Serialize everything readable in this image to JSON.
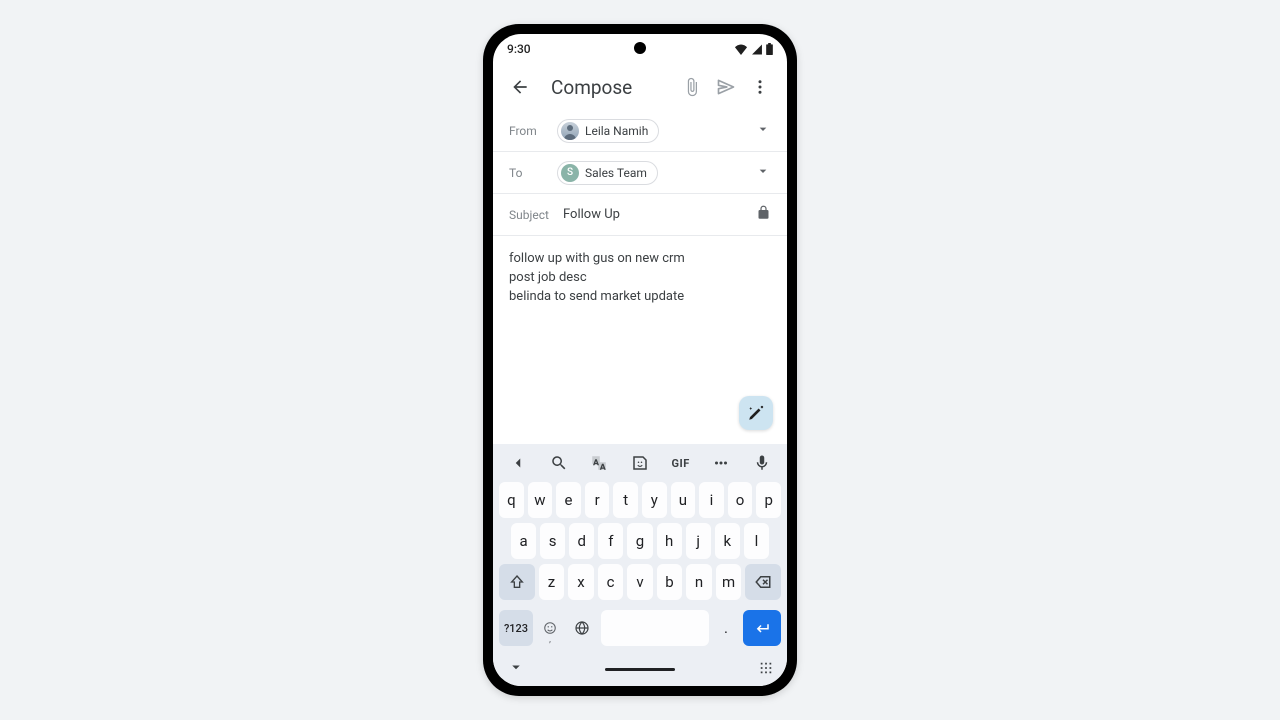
{
  "status": {
    "time": "9:30"
  },
  "header": {
    "title": "Compose"
  },
  "from": {
    "label": "From",
    "name": "Leila Namih"
  },
  "to": {
    "label": "To",
    "name": "Sales Team",
    "initial": "S"
  },
  "subject": {
    "label": "Subject",
    "value": "Follow Up"
  },
  "body": {
    "line1": "follow up with gus on new crm",
    "line2": "post job desc",
    "line3": "belinda to send market update"
  },
  "kb": {
    "gif": "GIF",
    "r1": {
      "k0": "q",
      "k1": "w",
      "k2": "e",
      "k3": "r",
      "k4": "t",
      "k5": "y",
      "k6": "u",
      "k7": "i",
      "k8": "o",
      "k9": "p"
    },
    "r2": {
      "k0": "a",
      "k1": "s",
      "k2": "d",
      "k3": "f",
      "k4": "g",
      "k5": "h",
      "k6": "j",
      "k7": "k",
      "k8": "l"
    },
    "r3": {
      "k0": "z",
      "k1": "x",
      "k2": "c",
      "k3": "v",
      "k4": "b",
      "k5": "n",
      "k6": "m"
    },
    "sym": "?123",
    "comma": ",",
    "dot": "."
  }
}
